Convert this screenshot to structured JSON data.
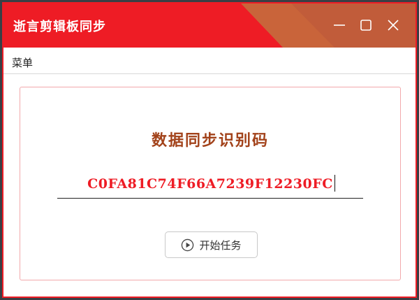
{
  "window": {
    "title": "逝言剪辑板同步",
    "controls": {
      "minimize_icon": "minimize-icon",
      "maximize_icon": "maximize-icon",
      "close_icon": "close-icon"
    }
  },
  "menu": {
    "items": [
      {
        "label": "菜单"
      }
    ]
  },
  "sync": {
    "label": "数据同步识别码",
    "code": "C0FA81C74F66A7239F12230FC"
  },
  "actions": {
    "start_label": "开始任务",
    "start_icon": "play-circle-icon"
  },
  "colors": {
    "accent": "#ee1c25",
    "title_accent": "#c9643a",
    "label": "#a2421a",
    "panel_border": "#f2a8ab"
  }
}
